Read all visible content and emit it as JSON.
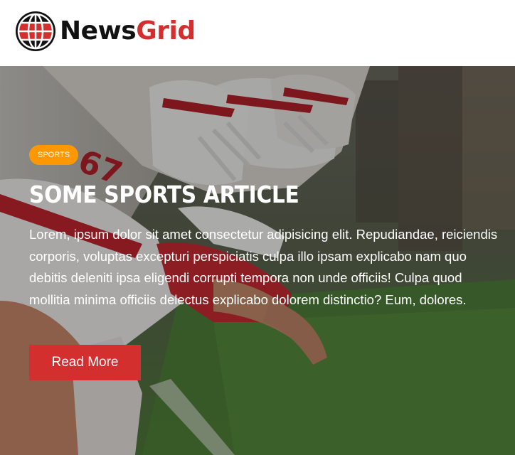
{
  "brand": {
    "name_part1": "News",
    "name_part2": "Grid",
    "logo_icon": "globe-icon",
    "colors": {
      "dark": "#111111",
      "red": "#d32f2f"
    }
  },
  "hero": {
    "image": "football-players-lineup-image",
    "category": "Sports",
    "category_color": "#ff9800",
    "title": "Some Sports Article",
    "excerpt": "Lorem, ipsum dolor sit amet consectetur adipisicing elit. Repudiandae, reiciendis corporis, voluptas excepturi perspiciatis culpa illo ipsam explicabo nam quo debitis deleniti ipsa eligendi corrupti tempora non unde officiis! Culpa quod mollitia minima officiis delectus explicabo dolorem distinctio? Eum, dolores.",
    "button_label": "Read More",
    "button_color": "#d32f2f"
  }
}
